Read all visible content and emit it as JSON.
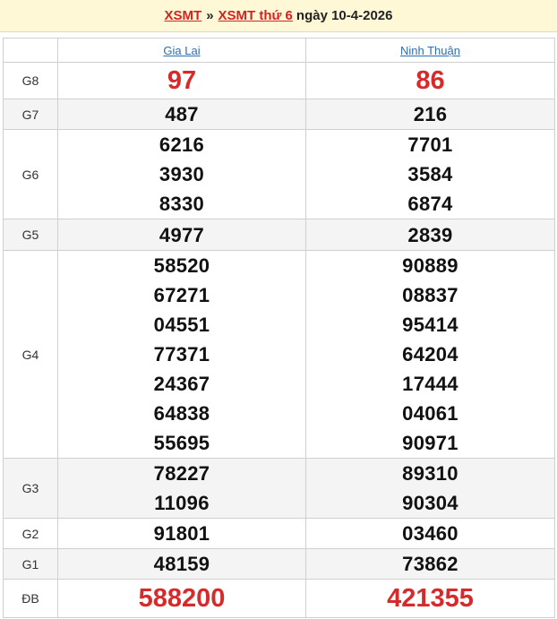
{
  "header": {
    "link_xsmt": "XSMT",
    "separator": "»",
    "link_day": "XSMT thứ 6",
    "date_text": "ngày 10-4-2026"
  },
  "columns": {
    "province_1": "Gia Lai",
    "province_2": "Ninh Thuận"
  },
  "prizes": {
    "g8": {
      "label": "G8",
      "p1": "97",
      "p2": "86"
    },
    "g7": {
      "label": "G7",
      "p1": "487",
      "p2": "216"
    },
    "g6": {
      "label": "G6",
      "p1": [
        "6216",
        "3930",
        "8330"
      ],
      "p2": [
        "7701",
        "3584",
        "6874"
      ]
    },
    "g5": {
      "label": "G5",
      "p1": "4977",
      "p2": "2839"
    },
    "g4": {
      "label": "G4",
      "p1": [
        "58520",
        "67271",
        "04551",
        "77371",
        "24367",
        "64838",
        "55695"
      ],
      "p2": [
        "90889",
        "08837",
        "95414",
        "64204",
        "17444",
        "04061",
        "90971"
      ]
    },
    "g3": {
      "label": "G3",
      "p1": [
        "78227",
        "11096"
      ],
      "p2": [
        "89310",
        "90304"
      ]
    },
    "g2": {
      "label": "G2",
      "p1": "91801",
      "p2": "03460"
    },
    "g1": {
      "label": "G1",
      "p1": "48159",
      "p2": "73862"
    },
    "db": {
      "label": "ĐB",
      "p1": "588200",
      "p2": "421355"
    }
  },
  "colors": {
    "header_bg": "#fff8d6",
    "link_red": "#d32222",
    "province_link": "#2a6fb3",
    "special_red": "#d72a2a",
    "alt_row": "#f4f4f4"
  }
}
